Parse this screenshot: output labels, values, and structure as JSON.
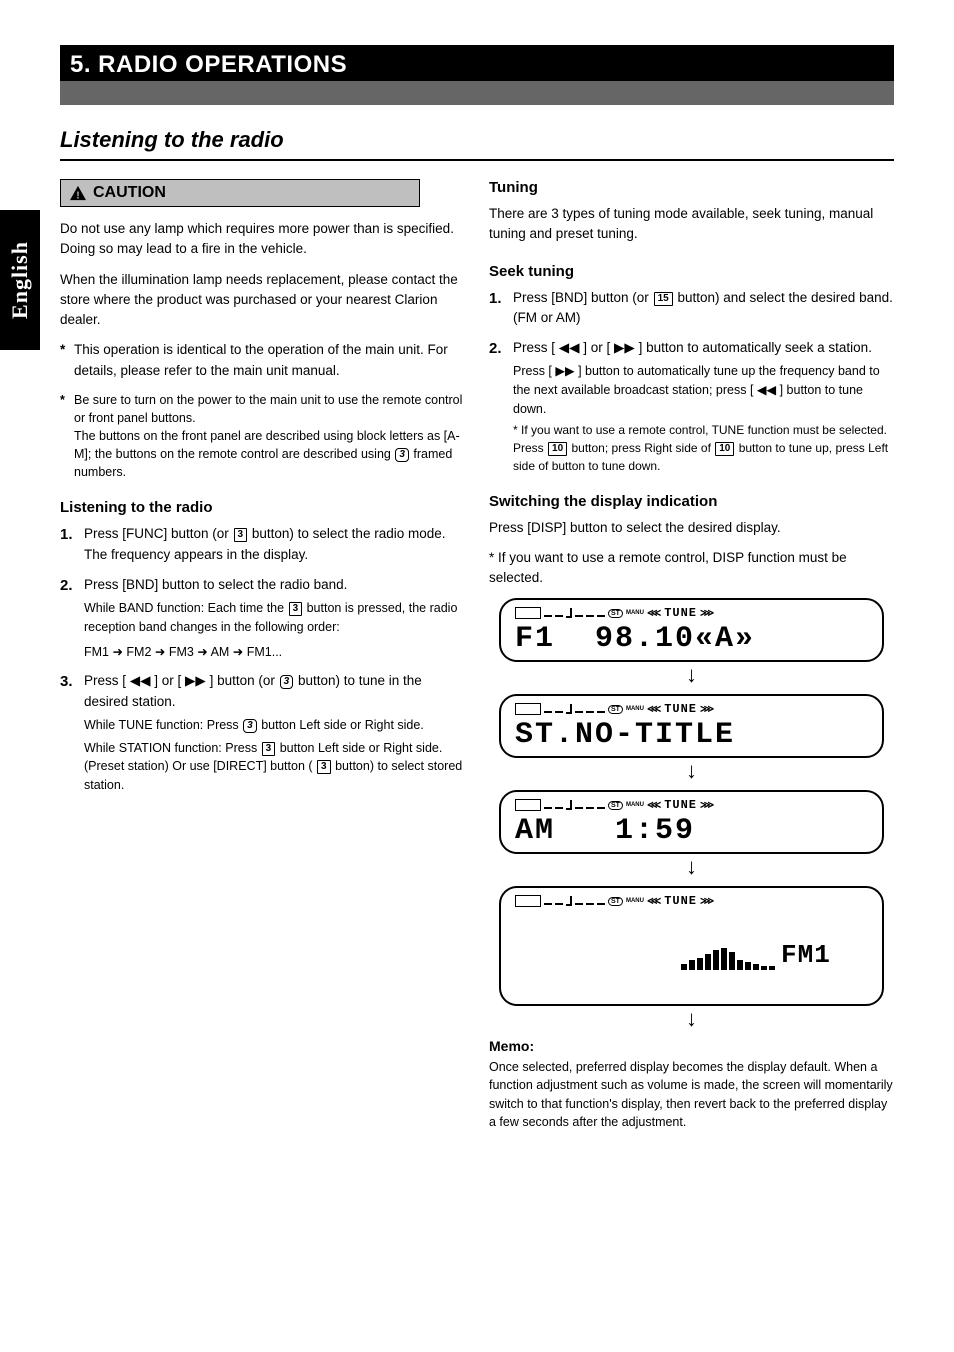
{
  "header": {
    "title": "5. RADIO OPERATIONS",
    "section_title": "Listening to the radio",
    "caution_label": "CAUTION",
    "lang_tab": "English"
  },
  "left": {
    "caution_text": "Do not use any lamp which requires more power than is specified. Doing so may lead to a fire in the vehicle.",
    "lamp_para": "When the illumination lamp needs replacement, please contact the store where the product was purchased or your nearest Clarion dealer.",
    "asterisk1": "This operation is identical to the operation of the main unit. For details, please refer to the main unit manual.",
    "asterisk2_1": "Be sure to turn on the power to the main unit to use the remote control or front panel buttons.",
    "asterisk2_2": "The buttons on the front panel are described using block letters as [A-M]; the buttons on the remote control are described using ",
    "asterisk2_3": " framed numbers.",
    "listening_heading": "Listening to the radio",
    "step1_a": "Press [FUNC] button (or ",
    "step1_b": " button) to select the radio mode. The frequency appears in the display.",
    "step2_a": "Press [BND] button to select the radio band.",
    "step2_b": "While BAND function: Each time the ",
    "step2_c": " button is pressed, the radio reception band changes in the following order:",
    "step2_seq": "FM1 ➜ FM2 ➜ FM3 ➜ AM ➜ FM1...",
    "step3_a": "Press [ ",
    "step3_a2": " ] or [ ",
    "step3_a3": " ] button (or ",
    "step3_b": " button) to tune in the desired station.",
    "step3_c": "While TUNE function: Press ",
    "step3_d": " button Left side or Right side.",
    "step3_e": "While STATION function: Press ",
    "step3_f": " button Left side or Right side. (Preset station) Or use [DIRECT] button (",
    "step3_g": " button) to select stored station.",
    "arrow_left": "◀◀",
    "arrow_right": "▶▶"
  },
  "right": {
    "tuning_heading": "Tuning",
    "tuning_intro": "There are 3 types of tuning mode available, seek tuning, manual tuning and preset tuning.",
    "seek_heading": "Seek tuning",
    "seek_1a": "Press [BND] button (or ",
    "seek_1b": " button) and select the desired band. (FM or AM)",
    "seek_2a": "Press [ ",
    "seek_2b": " ] or [ ",
    "seek_2c": " ] button to automatically seek a station.",
    "seek_3a": "Press [ ",
    "seek_3b": " ] button to automatically tune up the frequency band to the next available broadcast station; press [ ",
    "seek_3c": " ] button to tune down.",
    "seek_note": "If you want to use a remote control, TUNE function must be selected. Press ",
    "seek_note2": " button; press Right side of ",
    "seek_note3": " button to tune up, press Left side of button to tune down.",
    "switch_heading": "Switching the display indication",
    "switch_text": "Press [DISP] button to select the desired display.",
    "switch_note": "If you want to use a remote control, DISP function must be selected.",
    "lcd1": "F1  98.10«A»",
    "lcd2": "ST.NO-TITLE",
    "lcd3": "AM   1:59",
    "lcd4_suffix": "FM1",
    "tune_label": "TUNE",
    "memo_title": "Memo:",
    "memo_text": "Once selected, preferred display becomes the display default. When a function adjustment such as volume is made, the screen will momentarily switch to that function's display, then revert back to the preferred display a few seconds after the adjustment.",
    "key15": "15",
    "key10": "10",
    "key3": "3",
    "key3i": "3"
  }
}
